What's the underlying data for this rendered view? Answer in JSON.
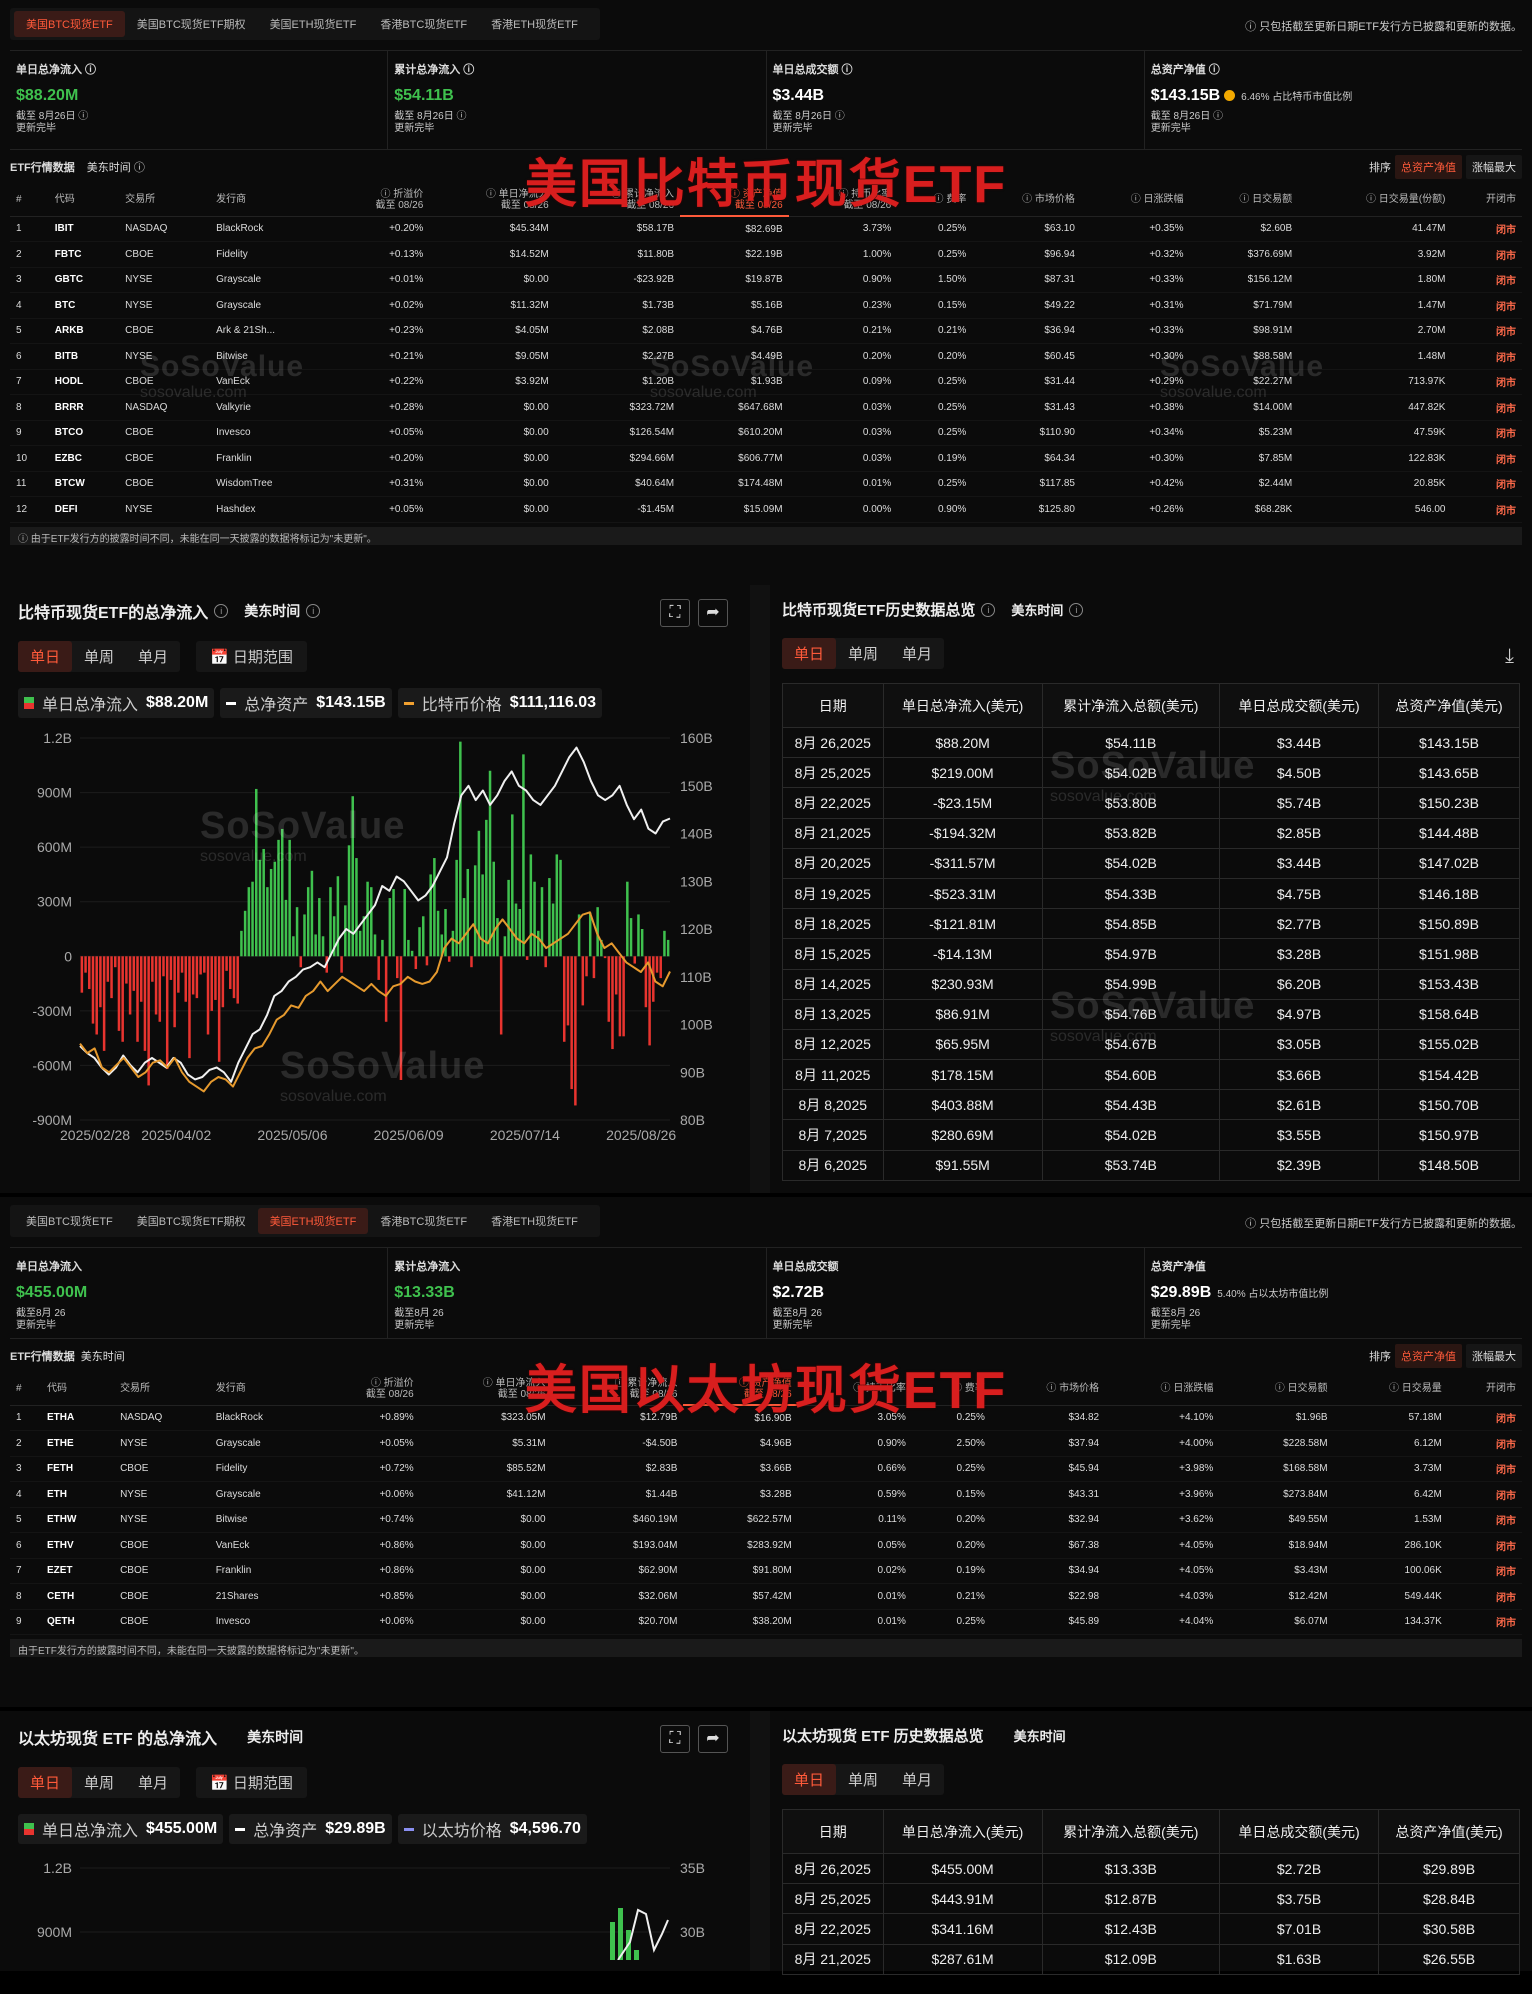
{
  "btc": {
    "tabs": [
      "美国BTC现货ETF",
      "美国BTC现货ETF期权",
      "美国ETH现货ETF",
      "香港BTC现货ETF",
      "香港ETH现货ETF"
    ],
    "notice": "ⓘ 只包括截至更新日期ETF发行方已披露和更新的数据。",
    "stats": [
      {
        "label": "单日总净流入 ⓘ",
        "value": "$88.20M",
        "sub1": "截至 8月26日 ⓘ",
        "sub2": "更新完毕",
        "ratio": ""
      },
      {
        "label": "累计总净流入 ⓘ",
        "value": "$54.11B",
        "sub1": "截至 8月26日 ⓘ",
        "sub2": "更新完毕",
        "ratio": ""
      },
      {
        "label": "单日总成交额 ⓘ",
        "value": "$3.44B",
        "sub1": "截至 8月26日 ⓘ",
        "sub2": "更新完毕",
        "ratio": ""
      },
      {
        "label": "总资产净值 ⓘ",
        "value": "$143.15B",
        "sub1": "截至 8月26日 ⓘ",
        "sub2": "更新完毕",
        "ratio": "6.46% 占比特币市值比例"
      }
    ],
    "section_title": "ETF行情数据",
    "section_tz": "美东时间 ⓘ",
    "sort_label": "排序",
    "sort_opts": [
      "总资产净值",
      "涨幅最大"
    ],
    "overlay": "美国比特币现货ETF",
    "headers": [
      "#",
      "代码",
      "交易所",
      "发行商",
      "ⓘ  折溢价\n截至 08/26",
      "ⓘ  单日净流入\n截至 08/26",
      "ⓘ  累计净流入\n截至 08/26",
      "ⓘ  资产净值\n截至 08/26",
      "ⓘ  持币比率\n截至 08/26",
      "ⓘ  费率",
      "ⓘ  市场价格",
      "ⓘ  日涨跌幅",
      "ⓘ  日交易额",
      "ⓘ  日交易量(份额)",
      "开闭市"
    ],
    "rows": [
      [
        "1",
        "IBIT",
        "NASDAQ",
        "BlackRock",
        "+0.20%",
        "$45.34M",
        "$58.17B",
        "$82.69B",
        "3.73%",
        "0.25%",
        "$63.10",
        "+0.35%",
        "$2.60B",
        "41.47M",
        "闭市"
      ],
      [
        "2",
        "FBTC",
        "CBOE",
        "Fidelity",
        "+0.13%",
        "$14.52M",
        "$11.80B",
        "$22.19B",
        "1.00%",
        "0.25%",
        "$96.94",
        "+0.32%",
        "$376.69M",
        "3.92M",
        "闭市"
      ],
      [
        "3",
        "GBTC",
        "NYSE",
        "Grayscale",
        "+0.01%",
        "$0.00",
        "-$23.92B",
        "$19.87B",
        "0.90%",
        "1.50%",
        "$87.31",
        "+0.33%",
        "$156.12M",
        "1.80M",
        "闭市"
      ],
      [
        "4",
        "BTC",
        "NYSE",
        "Grayscale",
        "+0.02%",
        "$11.32M",
        "$1.73B",
        "$5.16B",
        "0.23%",
        "0.15%",
        "$49.22",
        "+0.31%",
        "$71.79M",
        "1.47M",
        "闭市"
      ],
      [
        "5",
        "ARKB",
        "CBOE",
        "Ark & 21Sh...",
        "+0.23%",
        "$4.05M",
        "$2.08B",
        "$4.76B",
        "0.21%",
        "0.21%",
        "$36.94",
        "+0.33%",
        "$98.91M",
        "2.70M",
        "闭市"
      ],
      [
        "6",
        "BITB",
        "NYSE",
        "Bitwise",
        "+0.21%",
        "$9.05M",
        "$2.27B",
        "$4.49B",
        "0.20%",
        "0.20%",
        "$60.45",
        "+0.30%",
        "$88.58M",
        "1.48M",
        "闭市"
      ],
      [
        "7",
        "HODL",
        "CBOE",
        "VanEck",
        "+0.22%",
        "$3.92M",
        "$1.20B",
        "$1.93B",
        "0.09%",
        "0.25%",
        "$31.44",
        "+0.29%",
        "$22.27M",
        "713.97K",
        "闭市"
      ],
      [
        "8",
        "BRRR",
        "NASDAQ",
        "Valkyrie",
        "+0.28%",
        "$0.00",
        "$323.72M",
        "$647.68M",
        "0.03%",
        "0.25%",
        "$31.43",
        "+0.38%",
        "$14.00M",
        "447.82K",
        "闭市"
      ],
      [
        "9",
        "BTCO",
        "CBOE",
        "Invesco",
        "+0.05%",
        "$0.00",
        "$126.54M",
        "$610.20M",
        "0.03%",
        "0.25%",
        "$110.90",
        "+0.34%",
        "$5.23M",
        "47.59K",
        "闭市"
      ],
      [
        "10",
        "EZBC",
        "CBOE",
        "Franklin",
        "+0.20%",
        "$0.00",
        "$294.66M",
        "$606.77M",
        "0.03%",
        "0.19%",
        "$64.34",
        "+0.30%",
        "$7.85M",
        "122.83K",
        "闭市"
      ],
      [
        "11",
        "BTCW",
        "CBOE",
        "WisdomTree",
        "+0.31%",
        "$0.00",
        "$40.64M",
        "$174.48M",
        "0.01%",
        "0.25%",
        "$117.85",
        "+0.42%",
        "$2.44M",
        "20.85K",
        "闭市"
      ],
      [
        "12",
        "DEFI",
        "NYSE",
        "Hashdex",
        "+0.05%",
        "$0.00",
        "-$1.45M",
        "$15.09M",
        "0.00%",
        "0.90%",
        "$125.80",
        "+0.26%",
        "$68.28K",
        "546.00",
        "闭市"
      ]
    ],
    "footnote": "ⓘ 由于ETF发行方的披露时间不同，未能在同一天披露的数据将标记为\"未更新\"。",
    "watermark": "SoSoValue",
    "watermark_sub": "sosovalue.com"
  },
  "btc_chart": {
    "title": "比特币现货ETF的总净流入",
    "tz": "美东时间",
    "segs": [
      "单日",
      "单周",
      "单月"
    ],
    "range": "日期范围",
    "legend": [
      {
        "name": "单日总净流入",
        "value": "$88.20M",
        "color": "#3fc14e"
      },
      {
        "name": "总净资产",
        "value": "$143.15B",
        "color": "#ffffff"
      },
      {
        "name": "比特币价格",
        "value": "$111,116.03",
        "color": "#f0a030"
      }
    ],
    "colors": {
      "pos": "#3fc14e",
      "neg": "#e8342f",
      "nav": "#f0f0f0",
      "price": "#e69a2e"
    }
  },
  "chart_data": {
    "type": "bar",
    "yleft_ticks": [
      "1.2B",
      "900M",
      "600M",
      "300M",
      "0",
      "-300M",
      "-600M",
      "-900M"
    ],
    "yright_ticks": [
      "160B",
      "150B",
      "140B",
      "130B",
      "120B",
      "110B",
      "100B",
      "90B",
      "80B"
    ],
    "x_ticks": [
      "2025/02/28",
      "2025/04/02",
      "2025/05/06",
      "2025/06/09",
      "2025/07/14",
      "2025/08/26"
    ],
    "ylim_left": [
      -900,
      1200
    ],
    "ylim_right": [
      80,
      160
    ],
    "flows_musd": [
      -200,
      -90,
      -180,
      -370,
      -430,
      -280,
      -520,
      -140,
      -230,
      -60,
      -410,
      -470,
      -150,
      -320,
      -190,
      -470,
      -250,
      -520,
      -710,
      -140,
      -320,
      -360,
      -110,
      -620,
      -130,
      -390,
      -200,
      -90,
      -250,
      -560,
      -210,
      -230,
      -100,
      -90,
      -430,
      -300,
      -240,
      -580,
      -280,
      -80,
      -180,
      -230,
      -260,
      140,
      250,
      380,
      410,
      920,
      530,
      590,
      380,
      480,
      520,
      640,
      700,
      310,
      640,
      110,
      270,
      -60,
      230,
      380,
      470,
      120,
      320,
      110,
      -90,
      380,
      220,
      440,
      -90,
      280,
      610,
      880,
      540,
      140,
      220,
      410,
      380,
      120,
      -130,
      90,
      -360,
      320,
      370,
      -120,
      -680,
      370,
      90,
      30,
      -70,
      160,
      220,
      -50,
      450,
      540,
      250,
      120,
      260,
      -30,
      140,
      530,
      1180,
      320,
      480,
      -60,
      500,
      690,
      450,
      750,
      1020,
      520,
      210,
      -430,
      110,
      420,
      780,
      290,
      260,
      1110,
      -20,
      560,
      410,
      140,
      380,
      -60,
      430,
      290,
      560,
      530,
      -470,
      -380,
      -730,
      -820,
      230,
      -270,
      -110,
      240,
      -120,
      270,
      90,
      -10,
      -360,
      -510,
      -210,
      -440,
      -440,
      410,
      210,
      -40,
      230,
      150,
      -280,
      -490,
      -250,
      -90,
      -120,
      140,
      90
    ],
    "series": [
      {
        "name": "总净资产",
        "unit": "B",
        "values": [
          95.5,
          94,
          93,
          91,
          89.5,
          91,
          93.5,
          91.5,
          90,
          92,
          93,
          92,
          91,
          93,
          92,
          89.5,
          88.5,
          89,
          90.5,
          91,
          90,
          88,
          92,
          95,
          98,
          99,
          102,
          106,
          107,
          109,
          110,
          111.5,
          112,
          113,
          112,
          115,
          118,
          120,
          119,
          121,
          123,
          125,
          129,
          128,
          131,
          130,
          128,
          126,
          127,
          129,
          132,
          135,
          142,
          148,
          150,
          147,
          149,
          146,
          148,
          151,
          153,
          150,
          149,
          147,
          146,
          148,
          150,
          153,
          156,
          158,
          155,
          151,
          148,
          147,
          148,
          150,
          146,
          143,
          145,
          141,
          140,
          142.5,
          143.15
        ]
      },
      {
        "name": "比特币价格",
        "unit": "B",
        "values": [
          96,
          94,
          95,
          91,
          90,
          91.5,
          93,
          91,
          89,
          90,
          92,
          92.5,
          91,
          93,
          90,
          88,
          87,
          86,
          88,
          89,
          88.5,
          87,
          90,
          93,
          95,
          95.5,
          98,
          101,
          102,
          104,
          103.5,
          106,
          107,
          109,
          107,
          108.5,
          110,
          109,
          108,
          107,
          108.5,
          107,
          106,
          108,
          108.5,
          110,
          109,
          108.5,
          109,
          111,
          116,
          118,
          117,
          119,
          121,
          118,
          117,
          120,
          122,
          120,
          118,
          117,
          119,
          118,
          116,
          117,
          118,
          119,
          121,
          123,
          123.5,
          119,
          116,
          117,
          115,
          113,
          112,
          111,
          113,
          109,
          108,
          111.1
        ]
      }
    ]
  },
  "btc_hist": {
    "title": "比特币现货ETF历史数据总览",
    "tz": "美东时间",
    "segs": [
      "单日",
      "单周",
      "单月"
    ],
    "headers": [
      "日期",
      "单日总净流入(美元)",
      "累计净流入总额(美元)",
      "单日总成交额(美元)",
      "总资产净值(美元)"
    ],
    "rows": [
      [
        "8月 26,2025",
        "$88.20M",
        "$54.11B",
        "$3.44B",
        "$143.15B"
      ],
      [
        "8月 25,2025",
        "$219.00M",
        "$54.02B",
        "$4.50B",
        "$143.65B"
      ],
      [
        "8月 22,2025",
        "-$23.15M",
        "$53.80B",
        "$5.74B",
        "$150.23B"
      ],
      [
        "8月 21,2025",
        "-$194.32M",
        "$53.82B",
        "$2.85B",
        "$144.48B"
      ],
      [
        "8月 20,2025",
        "-$311.57M",
        "$54.02B",
        "$3.44B",
        "$147.02B"
      ],
      [
        "8月 19,2025",
        "-$523.31M",
        "$54.33B",
        "$4.75B",
        "$146.18B"
      ],
      [
        "8月 18,2025",
        "-$121.81M",
        "$54.85B",
        "$2.77B",
        "$150.89B"
      ],
      [
        "8月 15,2025",
        "-$14.13M",
        "$54.97B",
        "$3.28B",
        "$151.98B"
      ],
      [
        "8月 14,2025",
        "$230.93M",
        "$54.99B",
        "$6.20B",
        "$153.43B"
      ],
      [
        "8月 13,2025",
        "$86.91M",
        "$54.76B",
        "$4.97B",
        "$158.64B"
      ],
      [
        "8月 12,2025",
        "$65.95M",
        "$54.67B",
        "$3.05B",
        "$155.02B"
      ],
      [
        "8月 11,2025",
        "$178.15M",
        "$54.60B",
        "$3.66B",
        "$154.42B"
      ],
      [
        "8月 8,2025",
        "$403.88M",
        "$54.43B",
        "$2.61B",
        "$150.70B"
      ],
      [
        "8月 7,2025",
        "$280.69M",
        "$54.02B",
        "$3.55B",
        "$150.97B"
      ],
      [
        "8月 6,2025",
        "$91.55M",
        "$53.74B",
        "$2.39B",
        "$148.50B"
      ]
    ]
  },
  "eth": {
    "tabs": [
      "美国BTC现货ETF",
      "美国BTC现货ETF期权",
      "美国ETH现货ETF",
      "香港BTC现货ETF",
      "香港ETH现货ETF"
    ],
    "notice": "ⓘ 只包括截至更新日期ETF发行方已披露和更新的数据。",
    "stats": [
      {
        "label": "单日总净流入",
        "value": "$455.00M",
        "sub1": "截至8月 26",
        "sub2": "更新完毕",
        "ratio": ""
      },
      {
        "label": "累计总净流入",
        "value": "$13.33B",
        "sub1": "截至8月 26",
        "sub2": "更新完毕",
        "ratio": ""
      },
      {
        "label": "单日总成交额",
        "value": "$2.72B",
        "sub1": "截至8月 26",
        "sub2": "更新完毕",
        "ratio": ""
      },
      {
        "label": "总资产净值",
        "value": "$29.89B",
        "sub1": "截至8月 26",
        "sub2": "更新完毕",
        "ratio": "5.40% 占以太坊市值比例"
      }
    ],
    "section_title": "ETF行情数据",
    "section_tz": "美东时间",
    "sort_label": "排序",
    "sort_opts": [
      "总资产净值",
      "涨幅最大"
    ],
    "overlay": "美国以太坊现货ETF",
    "headers": [
      "#",
      "代码",
      "交易所",
      "发行商",
      "ⓘ  折溢价\n截至 08/26",
      "ⓘ  单日净流入\n截至 08/26",
      "ⓘ  累计净流入\n截至 08/26",
      "ⓘ  资产净值\n截至 08/26",
      "ⓘ  持币比率",
      "ⓘ  费率",
      "ⓘ  市场价格",
      "ⓘ  日涨跌幅",
      "ⓘ  日交易额",
      "ⓘ  日交易量",
      "开闭市"
    ],
    "rows": [
      [
        "1",
        "ETHA",
        "NASDAQ",
        "BlackRock",
        "+0.89%",
        "$323.05M",
        "$12.79B",
        "$16.90B",
        "3.05%",
        "0.25%",
        "$34.82",
        "+4.10%",
        "$1.96B",
        "57.18M",
        "闭市"
      ],
      [
        "2",
        "ETHE",
        "NYSE",
        "Grayscale",
        "+0.05%",
        "$5.31M",
        "-$4.50B",
        "$4.96B",
        "0.90%",
        "2.50%",
        "$37.94",
        "+4.00%",
        "$228.58M",
        "6.12M",
        "闭市"
      ],
      [
        "3",
        "FETH",
        "CBOE",
        "Fidelity",
        "+0.72%",
        "$85.52M",
        "$2.83B",
        "$3.66B",
        "0.66%",
        "0.25%",
        "$45.94",
        "+3.98%",
        "$168.58M",
        "3.73M",
        "闭市"
      ],
      [
        "4",
        "ETH",
        "NYSE",
        "Grayscale",
        "+0.06%",
        "$41.12M",
        "$1.44B",
        "$3.28B",
        "0.59%",
        "0.15%",
        "$43.31",
        "+3.96%",
        "$273.84M",
        "6.42M",
        "闭市"
      ],
      [
        "5",
        "ETHW",
        "NYSE",
        "Bitwise",
        "+0.74%",
        "$0.00",
        "$460.19M",
        "$622.57M",
        "0.11%",
        "0.20%",
        "$32.94",
        "+3.62%",
        "$49.55M",
        "1.53M",
        "闭市"
      ],
      [
        "6",
        "ETHV",
        "CBOE",
        "VanEck",
        "+0.86%",
        "$0.00",
        "$193.04M",
        "$283.92M",
        "0.05%",
        "0.20%",
        "$67.38",
        "+4.05%",
        "$18.94M",
        "286.10K",
        "闭市"
      ],
      [
        "7",
        "EZET",
        "CBOE",
        "Franklin",
        "+0.86%",
        "$0.00",
        "$62.90M",
        "$91.80M",
        "0.02%",
        "0.19%",
        "$34.94",
        "+4.05%",
        "$3.43M",
        "100.06K",
        "闭市"
      ],
      [
        "8",
        "CETH",
        "CBOE",
        "21Shares",
        "+0.85%",
        "$0.00",
        "$32.06M",
        "$57.42M",
        "0.01%",
        "0.21%",
        "$22.98",
        "+4.03%",
        "$12.42M",
        "549.44K",
        "闭市"
      ],
      [
        "9",
        "QETH",
        "CBOE",
        "Invesco",
        "+0.06%",
        "$0.00",
        "$20.70M",
        "$38.20M",
        "0.01%",
        "0.25%",
        "$45.89",
        "+4.04%",
        "$6.07M",
        "134.37K",
        "闭市"
      ]
    ],
    "footnote": "由于ETF发行方的披露时间不同，未能在同一天披露的数据将标记为\"未更新\"。"
  },
  "eth_chart": {
    "title": "以太坊现货 ETF 的总净流入",
    "tz": "美东时间",
    "segs": [
      "单日",
      "单周",
      "单月"
    ],
    "range": "日期范围",
    "legend": [
      {
        "name": "单日总净流入",
        "value": "$455.00M",
        "color": "#3fc14e"
      },
      {
        "name": "总净资产",
        "value": "$29.89B",
        "color": "#ffffff"
      },
      {
        "name": "以太坊价格",
        "value": "$4,596.70",
        "color": "#8a8ff0"
      }
    ],
    "yleft_ticks": [
      "1.2B",
      "900M"
    ],
    "yright_ticks": [
      "35B",
      "30B"
    ]
  },
  "eth_hist": {
    "title": "以太坊现货 ETF 历史数据总览",
    "tz": "美东时间",
    "segs": [
      "单日",
      "单周",
      "单月"
    ],
    "headers": [
      "日期",
      "单日总净流入(美元)",
      "累计净流入总额(美元)",
      "单日总成交额(美元)",
      "总资产净值(美元)"
    ],
    "rows": [
      [
        "8月 26,2025",
        "$455.00M",
        "$13.33B",
        "$2.72B",
        "$29.89B"
      ],
      [
        "8月 25,2025",
        "$443.91M",
        "$12.87B",
        "$3.75B",
        "$28.84B"
      ],
      [
        "8月 22,2025",
        "$341.16M",
        "$12.43B",
        "$7.01B",
        "$30.58B"
      ],
      [
        "8月 21,2025",
        "$287.61M",
        "$12.09B",
        "$1.63B",
        "$26.55B"
      ]
    ]
  }
}
